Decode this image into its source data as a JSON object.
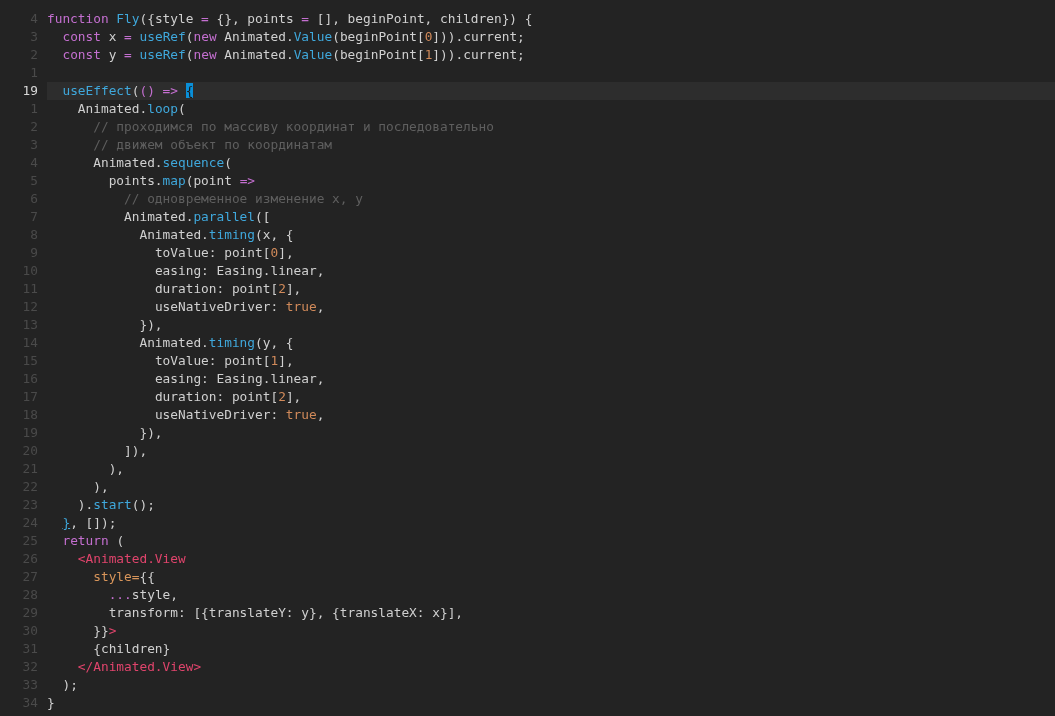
{
  "editor": {
    "lines": [
      {
        "number": "4",
        "current": false,
        "tokens": [
          {
            "kind": "keyword",
            "text": "function "
          },
          {
            "kind": "function",
            "text": "Fly"
          },
          {
            "kind": "plain",
            "text": "({style "
          },
          {
            "kind": "keyword",
            "text": "="
          },
          {
            "kind": "plain",
            "text": " {}, points "
          },
          {
            "kind": "keyword",
            "text": "="
          },
          {
            "kind": "plain",
            "text": " [], beginPoint, children}) {"
          }
        ]
      },
      {
        "number": "3",
        "current": false,
        "tokens": [
          {
            "kind": "keyword",
            "text": "  const"
          },
          {
            "kind": "plain",
            "text": " x "
          },
          {
            "kind": "keyword",
            "text": "= "
          },
          {
            "kind": "function",
            "text": "useRef"
          },
          {
            "kind": "plain",
            "text": "("
          },
          {
            "kind": "keyword",
            "text": "new"
          },
          {
            "kind": "plain",
            "text": " Animated."
          },
          {
            "kind": "function",
            "text": "Value"
          },
          {
            "kind": "plain",
            "text": "(beginPoint["
          },
          {
            "kind": "number",
            "text": "0"
          },
          {
            "kind": "plain",
            "text": "])).current;"
          }
        ]
      },
      {
        "number": "2",
        "current": false,
        "tokens": [
          {
            "kind": "keyword",
            "text": "  const"
          },
          {
            "kind": "plain",
            "text": " y "
          },
          {
            "kind": "keyword",
            "text": "= "
          },
          {
            "kind": "function",
            "text": "useRef"
          },
          {
            "kind": "plain",
            "text": "("
          },
          {
            "kind": "keyword",
            "text": "new"
          },
          {
            "kind": "plain",
            "text": " Animated."
          },
          {
            "kind": "function",
            "text": "Value"
          },
          {
            "kind": "plain",
            "text": "(beginPoint["
          },
          {
            "kind": "number",
            "text": "1"
          },
          {
            "kind": "plain",
            "text": "])).current;"
          }
        ]
      },
      {
        "number": "1",
        "current": false
      },
      {
        "number": "19",
        "current": true,
        "tokens": [
          {
            "kind": "function",
            "text": "  useEffect"
          },
          {
            "kind": "plain",
            "text": "("
          },
          {
            "kind": "keyword",
            "text": "() => "
          },
          {
            "kind": "cursor-bracket",
            "text": "{"
          }
        ]
      },
      {
        "number": "1",
        "current": false,
        "tokens": [
          {
            "kind": "plain",
            "text": "    Animated."
          },
          {
            "kind": "function",
            "text": "loop"
          },
          {
            "kind": "plain",
            "text": "("
          }
        ]
      },
      {
        "number": "2",
        "current": false,
        "tokens": [
          {
            "kind": "comment",
            "text": "      // проходимся по массиву координат и последовательно"
          }
        ]
      },
      {
        "number": "3",
        "current": false,
        "tokens": [
          {
            "kind": "comment",
            "text": "      // движем объект по координатам"
          }
        ]
      },
      {
        "number": "4",
        "current": false,
        "tokens": [
          {
            "kind": "plain",
            "text": "      Animated."
          },
          {
            "kind": "function",
            "text": "sequence"
          },
          {
            "kind": "plain",
            "text": "("
          }
        ]
      },
      {
        "number": "5",
        "current": false,
        "tokens": [
          {
            "kind": "plain",
            "text": "        points."
          },
          {
            "kind": "function",
            "text": "map"
          },
          {
            "kind": "plain",
            "text": "(point "
          },
          {
            "kind": "keyword",
            "text": "=>"
          }
        ]
      },
      {
        "number": "6",
        "current": false,
        "tokens": [
          {
            "kind": "comment",
            "text": "          // одновременное изменение x, y"
          }
        ]
      },
      {
        "number": "7",
        "current": false,
        "tokens": [
          {
            "kind": "plain",
            "text": "          Animated."
          },
          {
            "kind": "function",
            "text": "parallel"
          },
          {
            "kind": "plain",
            "text": "(["
          }
        ]
      },
      {
        "number": "8",
        "current": false,
        "tokens": [
          {
            "kind": "plain",
            "text": "            Animated."
          },
          {
            "kind": "function",
            "text": "timing"
          },
          {
            "kind": "plain",
            "text": "(x, {"
          }
        ]
      },
      {
        "number": "9",
        "current": false,
        "tokens": [
          {
            "kind": "plain",
            "text": "              toValue: point["
          },
          {
            "kind": "number",
            "text": "0"
          },
          {
            "kind": "plain",
            "text": "],"
          }
        ]
      },
      {
        "number": "10",
        "current": false,
        "tokens": [
          {
            "kind": "plain",
            "text": "              easing: Easing.linear,"
          }
        ]
      },
      {
        "number": "11",
        "current": false,
        "tokens": [
          {
            "kind": "plain",
            "text": "              duration: point["
          },
          {
            "kind": "number",
            "text": "2"
          },
          {
            "kind": "plain",
            "text": "],"
          }
        ]
      },
      {
        "number": "12",
        "current": false,
        "tokens": [
          {
            "kind": "plain",
            "text": "              useNativeDriver: "
          },
          {
            "kind": "number",
            "text": "true"
          },
          {
            "kind": "plain",
            "text": ","
          }
        ]
      },
      {
        "number": "13",
        "current": false,
        "tokens": [
          {
            "kind": "plain",
            "text": "            }),"
          }
        ]
      },
      {
        "number": "14",
        "current": false,
        "tokens": [
          {
            "kind": "plain",
            "text": "            Animated."
          },
          {
            "kind": "function",
            "text": "timing"
          },
          {
            "kind": "plain",
            "text": "(y, {"
          }
        ]
      },
      {
        "number": "15",
        "current": false,
        "tokens": [
          {
            "kind": "plain",
            "text": "              toValue: point["
          },
          {
            "kind": "number",
            "text": "1"
          },
          {
            "kind": "plain",
            "text": "],"
          }
        ]
      },
      {
        "number": "16",
        "current": false,
        "tokens": [
          {
            "kind": "plain",
            "text": "              easing: Easing.linear,"
          }
        ]
      },
      {
        "number": "17",
        "current": false,
        "tokens": [
          {
            "kind": "plain",
            "text": "              duration: point["
          },
          {
            "kind": "number",
            "text": "2"
          },
          {
            "kind": "plain",
            "text": "],"
          }
        ]
      },
      {
        "number": "18",
        "current": false,
        "tokens": [
          {
            "kind": "plain",
            "text": "              useNativeDriver: "
          },
          {
            "kind": "number",
            "text": "true"
          },
          {
            "kind": "plain",
            "text": ","
          }
        ]
      },
      {
        "number": "19",
        "current": false,
        "tokens": [
          {
            "kind": "plain",
            "text": "            }),"
          }
        ]
      },
      {
        "number": "20",
        "current": false,
        "tokens": [
          {
            "kind": "plain",
            "text": "          ]),"
          }
        ]
      },
      {
        "number": "21",
        "current": false,
        "tokens": [
          {
            "kind": "plain",
            "text": "        ),"
          }
        ]
      },
      {
        "number": "22",
        "current": false,
        "tokens": [
          {
            "kind": "plain",
            "text": "      ),"
          }
        ]
      },
      {
        "number": "23",
        "current": false,
        "tokens": [
          {
            "kind": "plain",
            "text": "    )."
          },
          {
            "kind": "function",
            "text": "start"
          },
          {
            "kind": "plain",
            "text": "();"
          }
        ]
      },
      {
        "number": "24",
        "current": false,
        "tokens": [
          {
            "kind": "matching-bracket",
            "text": "  }"
          },
          {
            "kind": "plain",
            "text": ", []);"
          }
        ]
      },
      {
        "number": "25",
        "current": false,
        "tokens": [
          {
            "kind": "keyword",
            "text": "  return"
          },
          {
            "kind": "plain",
            "text": " ("
          }
        ]
      },
      {
        "number": "26",
        "current": false,
        "tokens": [
          {
            "kind": "tag",
            "text": "    <Animated.View"
          }
        ]
      },
      {
        "number": "27",
        "current": false,
        "tokens": [
          {
            "kind": "attribute",
            "text": "      style="
          },
          {
            "kind": "plain",
            "text": "{{"
          }
        ]
      },
      {
        "number": "28",
        "current": false,
        "tokens": [
          {
            "kind": "keyword",
            "text": "        ..."
          },
          {
            "kind": "plain",
            "text": "style,"
          }
        ]
      },
      {
        "number": "29",
        "current": false,
        "tokens": [
          {
            "kind": "plain",
            "text": "        transform: [{translateY: y}, {translateX: x}],"
          }
        ]
      },
      {
        "number": "30",
        "current": false,
        "tokens": [
          {
            "kind": "plain",
            "text": "      }}"
          },
          {
            "kind": "tag",
            "text": ">"
          }
        ]
      },
      {
        "number": "31",
        "current": false,
        "tokens": [
          {
            "kind": "plain",
            "text": "      {children}"
          }
        ]
      },
      {
        "number": "32",
        "current": false,
        "tokens": [
          {
            "kind": "tag",
            "text": "    </Animated.View>"
          }
        ]
      },
      {
        "number": "33",
        "current": false,
        "tokens": [
          {
            "kind": "plain",
            "text": "  );"
          }
        ]
      },
      {
        "number": "34",
        "current": false,
        "tokens": [
          {
            "kind": "plain",
            "text": "}"
          }
        ]
      }
    ]
  }
}
